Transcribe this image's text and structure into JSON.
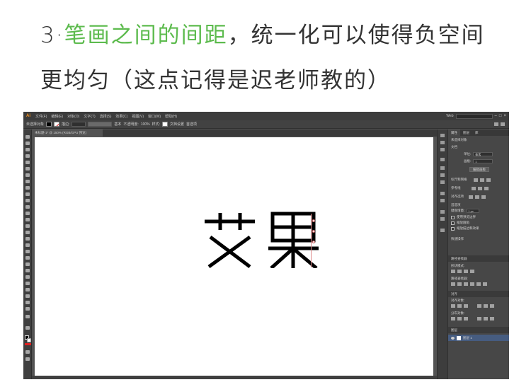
{
  "caption": {
    "line1_prefix": "3·",
    "line1_highlight": "笔画之间的间距",
    "line1_rest": "，统一化可以使得负空间",
    "line2": "更均匀（这点记得是迟老师教的）",
    "highlight_color": "#5dbb4e",
    "text_color": "#333333"
  },
  "app": {
    "logo": "Ai",
    "menus": [
      "文件(F)",
      "编辑(E)",
      "对象(O)",
      "文字(T)",
      "选择(S)",
      "效果(C)",
      "视图(V)",
      "窗口(W)",
      "帮助(H)"
    ],
    "workspace": "Web",
    "ctrlbar": {
      "selection_label": "未选择对象",
      "stroke_label": "描边:",
      "basic_label": "基本",
      "opacity_label": "不透明度:",
      "opacity_value": "100%",
      "style_label": "样式:",
      "doc_setup": "文档设置",
      "prefs": "首选项"
    },
    "doc_tab": "未标题-1* @ 150% (RGB/GPU 预览)",
    "artwork_text": "艾果",
    "panel": {
      "tabs": [
        "属性",
        "图层",
        "库"
      ],
      "no_selection": "未选择对象",
      "document_label": "文档",
      "units_label": "单位:",
      "units_value": "像素",
      "artboard_label": "画板:",
      "artboard_value": "1",
      "edit_artboard": "编辑画板",
      "ruler_grid": "标尺和网格",
      "guides": "参考线",
      "snap": "对齐选项",
      "prefs_label": "首选项",
      "keyboard_increment": "键盘增量:",
      "keyboard_value": "1 px",
      "opt_preview_bounds": "使用预览边界",
      "opt_scale_corners": "缩放圆角",
      "opt_scale_strokes": "缩放描边和效果",
      "quick_actions": "快速操作",
      "pathfinder_tab": "路径查找器",
      "shape_modes": "形状模式:",
      "pathfinders": "路径查找器:",
      "align_tab": "对齐",
      "align_objects": "对齐对象:",
      "distribute_objects": "分布对象:",
      "layers_tab": "图层",
      "layer_name": "图层 1"
    }
  }
}
